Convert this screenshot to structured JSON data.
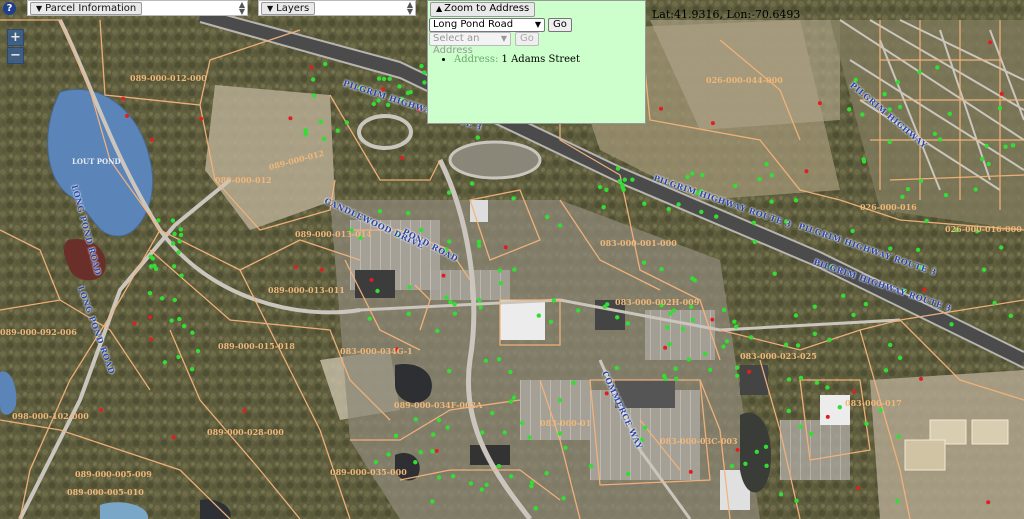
{
  "toolbar": {
    "help_icon": "question-icon",
    "parcel_info_label": "Parcel Information",
    "layers_label": "Layers"
  },
  "coordinates": "Lat:41.9316, Lon:-70.6493",
  "zoom_controls": {
    "zoom_in": "+",
    "zoom_out": "−"
  },
  "zoom_to_address": {
    "button_label": "Zoom to Address",
    "street_value": "Long Pond Road",
    "go_label": "Go",
    "address_placeholder": "Select an Address",
    "go2_label": "Go",
    "results": [
      {
        "label": "Address:",
        "value": "1 Adams Street"
      }
    ]
  },
  "map": {
    "pond_label": "LOUT POND",
    "parcel_labels": [
      "089-000-012-000",
      "089-000-012",
      "089-000-012",
      "089-000-013-014",
      "089-000-013-011",
      "089-000-015-018",
      "089-000-092-006",
      "098-000-102-000",
      "089-000-028-000",
      "089-000-005-009",
      "089-000-005-010",
      "089-000-035-000",
      "089-000-034F-002A",
      "083-000-001-000",
      "083-000-002H-009",
      "026-000-044-000",
      "026-000-016-000",
      "026-000-016",
      "083-000-023-025",
      "083-000-017",
      "083-000-01",
      "083-000-034G-1",
      "083-000-03C-003"
    ],
    "road_labels": [
      "PILGRIM HIGHWAY ROUTE 3",
      "PILGRIM HIGHWAY ROUTE 3",
      "PILGRIM HIGHWAY ROUTE 3",
      "PILGRIM HIGHWAY ROUTE 3",
      "LONG POND ROAD",
      "LONG POND ROAD",
      "CANDLEWOOD DRIVE",
      "COMMERCE WAY",
      "POND ROAD",
      "PILGRIM HIGHWAY"
    ],
    "colors": {
      "parcel_line": "#f4b37b",
      "green_marker": "#33dd33",
      "red_marker": "#e02020",
      "water": "#5b84b8",
      "road_label": "#2a46a8"
    }
  }
}
